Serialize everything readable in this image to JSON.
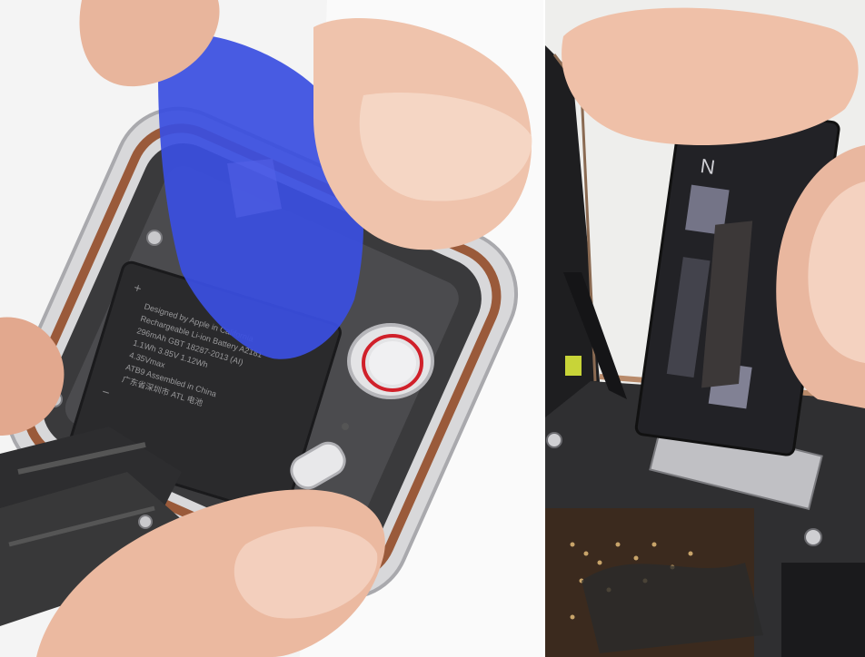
{
  "left_photo": {
    "battery_label_lines": [
      "Designed by Apple in California",
      "Rechargeable Li-ion Battery  A2181",
      "296mAh  GBT 18287-2013  (AI)",
      "1.1Wh  3.85V  1.12Wh",
      "4.35Vmax",
      "ATB9  Assembled in China",
      "广东省深圳市 ATL 电池"
    ],
    "colors": {
      "pick": "#3a4fe0",
      "crown_ring": "#d0202a",
      "battery": "#2a2a2c",
      "case_copper": "#9a5a3a",
      "case_silver": "#d8d8da"
    }
  },
  "right_photo": {
    "battery_marking": "N",
    "colors": {
      "battery": "#222226",
      "adhesive": "#3c3838",
      "yellow_component": "#c8d438"
    }
  }
}
